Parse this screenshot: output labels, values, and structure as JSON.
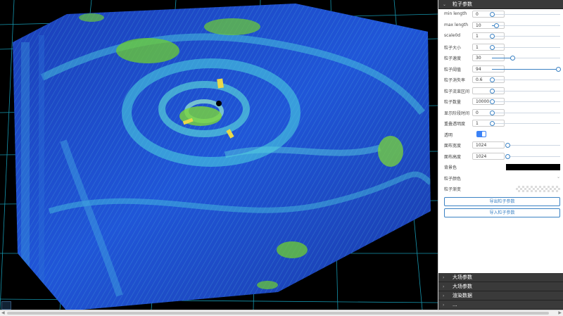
{
  "panel": {
    "particle_section_title": "粒子参数",
    "params": [
      {
        "label": "min length",
        "value": "0",
        "slider": 0.0
      },
      {
        "label": "max length",
        "value": "10",
        "slider": 0.06
      },
      {
        "label": "scale0d",
        "value": "1",
        "slider": 0.0
      },
      {
        "label": "粒子大小",
        "value": "1",
        "slider": 0.0
      },
      {
        "label": "粒子速度",
        "value": "30",
        "slider": 0.3
      },
      {
        "label": "粒子阈值",
        "value": "94",
        "slider": 0.97
      },
      {
        "label": "粒子消失率",
        "value": "0.6",
        "slider": 0.0
      },
      {
        "label": "粒子流束区间",
        "value": "",
        "slider": 0.0
      },
      {
        "label": "粒子数量",
        "value": "10000",
        "slider": 0.0
      },
      {
        "label": "显示阶段时间",
        "value": "0",
        "slider": 0.0
      },
      {
        "label": "重叠透明度",
        "value": "1",
        "slider": 0.0
      }
    ],
    "transparent_label": "透明",
    "bg_width_label": "面布宽度",
    "bg_width_value": "1024",
    "bg_height_label": "面布高度",
    "bg_height_value": "1024",
    "bg_color_label": "背景色",
    "bg_color": "#000000",
    "particle_color_label": "粒子颜色",
    "particle_gradient_label": "粒子渐变",
    "export_button": "导出粒子参数",
    "import_button": "导入粒子参数",
    "bottom_sections": [
      {
        "title": "大场参数"
      },
      {
        "title": "大场参数"
      },
      {
        "title": "渲染数据"
      },
      {
        "title": "..."
      }
    ]
  },
  "colors": {
    "accent": "#3b82c4",
    "panel_header": "#3a3a3a",
    "viewport_bg": "#000000",
    "grid": "#1ec8e8",
    "field_blue": "#1a4fd0",
    "field_cyan": "#4fd8e0",
    "field_green": "#6ecf30"
  }
}
